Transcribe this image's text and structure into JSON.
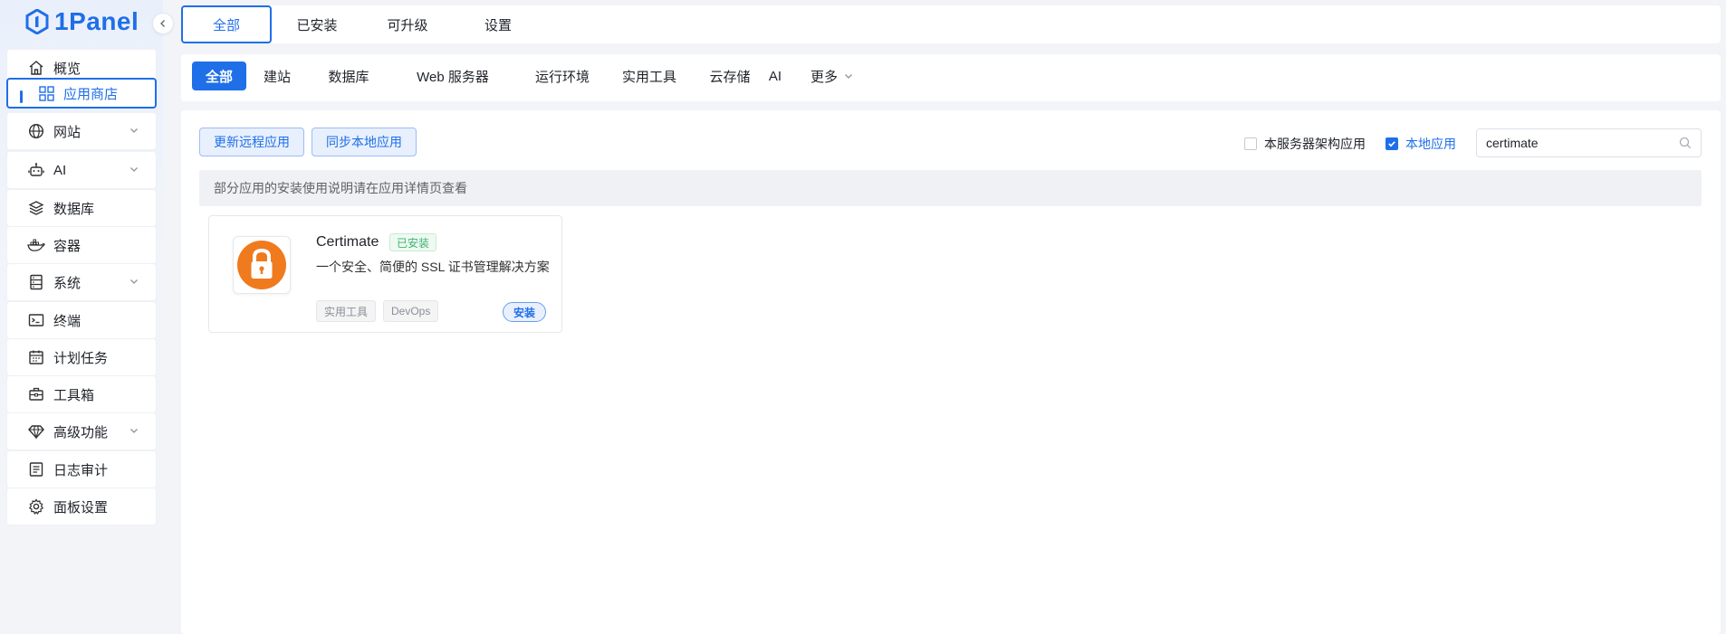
{
  "brand": {
    "name": "1Panel",
    "color": "#1f6fe8"
  },
  "sidebar": {
    "items": [
      {
        "label": "概览",
        "icon": "home-icon"
      },
      {
        "label": "应用商店",
        "icon": "grid-icon",
        "active": true
      },
      {
        "label": "网站",
        "icon": "globe-icon",
        "expandable": true
      },
      {
        "label": "AI",
        "icon": "robot-icon",
        "expandable": true
      },
      {
        "label": "数据库",
        "icon": "layers-icon"
      },
      {
        "label": "容器",
        "icon": "docker-icon"
      },
      {
        "label": "系统",
        "icon": "server-icon",
        "expandable": true
      },
      {
        "label": "终端",
        "icon": "terminal-icon"
      },
      {
        "label": "计划任务",
        "icon": "calendar-icon"
      },
      {
        "label": "工具箱",
        "icon": "toolbox-icon"
      },
      {
        "label": "高级功能",
        "icon": "diamond-icon",
        "expandable": true
      },
      {
        "label": "日志审计",
        "icon": "log-icon"
      },
      {
        "label": "面板设置",
        "icon": "gear-icon"
      }
    ]
  },
  "top_tabs": [
    "全部",
    "已安装",
    "可升级",
    "设置"
  ],
  "categories": [
    "全部",
    "建站",
    "数据库",
    "Web 服务器",
    "运行环境",
    "实用工具",
    "云存储",
    "AI",
    "更多"
  ],
  "toolbar": {
    "update_remote_label": "更新远程应用",
    "sync_local_label": "同步本地应用",
    "arch_filter_label": "本服务器架构应用",
    "local_filter_label": "本地应用",
    "search_value": "certimate"
  },
  "notice": "部分应用的安装使用说明请在应用详情页查看",
  "apps": [
    {
      "name": "Certimate",
      "status": "已安装",
      "description": "一个安全、简便的 SSL 证书管理解决方案",
      "tags": [
        "实用工具",
        "DevOps"
      ],
      "action": "安装",
      "icon": "lock-icon",
      "icon_color": "#f07a1e"
    }
  ]
}
